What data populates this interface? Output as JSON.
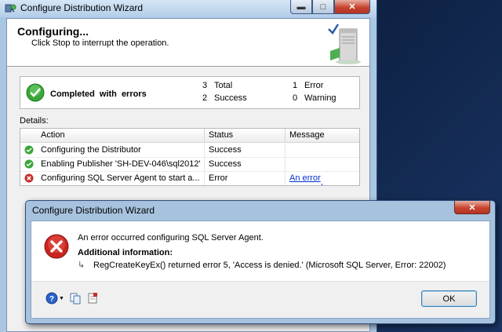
{
  "wizard": {
    "title": "Configure Distribution Wizard",
    "header_title": "Configuring...",
    "header_subtitle": "Click Stop to interrupt the operation.",
    "summary": {
      "status": "Completed with errors",
      "total_count": "3",
      "total_label": "Total",
      "success_count": "2",
      "success_label": "Success",
      "error_count": "1",
      "error_label": "Error",
      "warning_count": "0",
      "warning_label": "Warning"
    },
    "details_label": "Details:",
    "columns": {
      "action": "Action",
      "status": "Status",
      "message": "Message"
    },
    "rows": [
      {
        "icon": "success-icon",
        "action": "Configuring the Distributor",
        "status": "Success",
        "message": ""
      },
      {
        "icon": "success-icon",
        "action": "Enabling Publisher 'SH-DEV-046\\sql2012'",
        "status": "Success",
        "message": ""
      },
      {
        "icon": "error-icon",
        "action": "Configuring SQL Server Agent to start a...",
        "status": "Error",
        "message": "An error occurred..."
      }
    ]
  },
  "error_dialog": {
    "title": "Configure Distribution Wizard",
    "message": "An error occurred configuring SQL Server Agent.",
    "additional_label": "Additional information:",
    "arrow": "↳",
    "detail": "RegCreateKeyEx() returned error 5, 'Access is denied.' (Microsoft SQL Server, Error: 22002)",
    "ok_label": "OK"
  },
  "colors": {
    "success_green": "#3aa53a",
    "error_red": "#cc2b2b",
    "link_blue": "#0033cc"
  }
}
